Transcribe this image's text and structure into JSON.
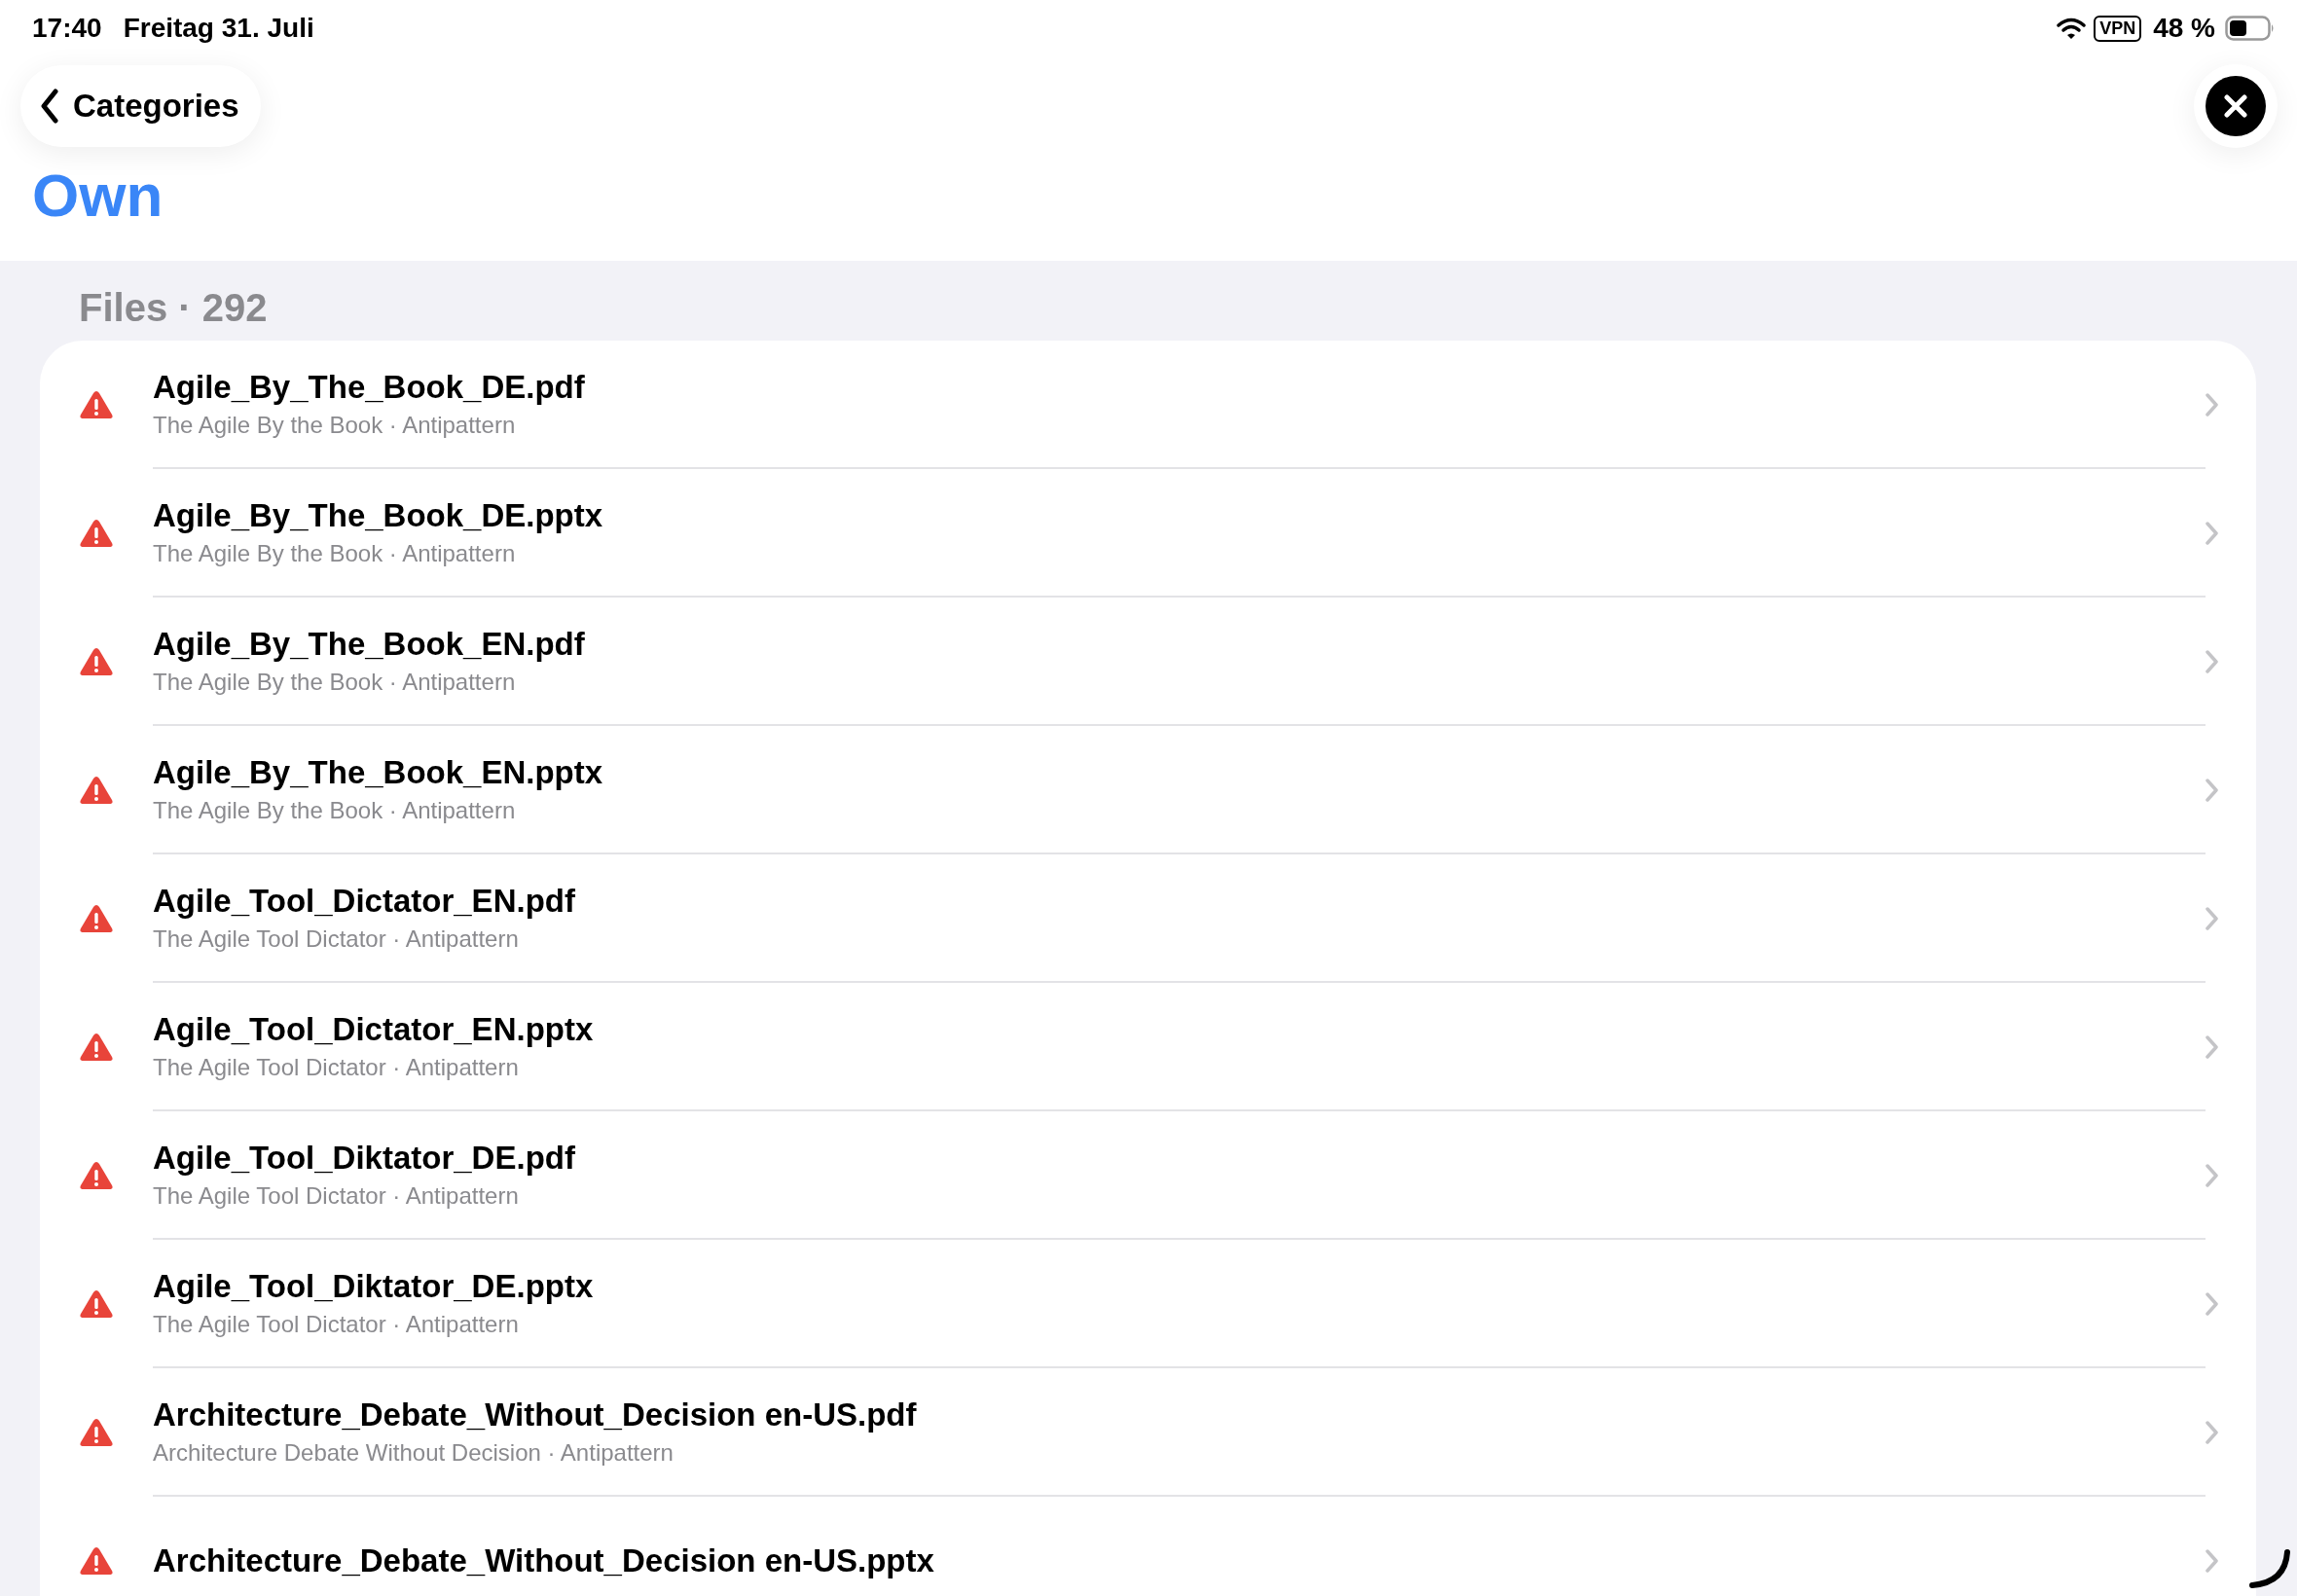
{
  "status_bar": {
    "time": "17:40",
    "date": "Freitag 31. Juli",
    "vpn": "VPN",
    "battery": "48 %"
  },
  "nav": {
    "back": "Categories",
    "title": "Own"
  },
  "section": {
    "header": "Files · 292"
  },
  "files": [
    {
      "name": "Agile_By_The_Book_DE.pdf",
      "subtitle": "The Agile By the Book · Antipattern"
    },
    {
      "name": "Agile_By_The_Book_DE.pptx",
      "subtitle": "The Agile By the Book · Antipattern"
    },
    {
      "name": "Agile_By_The_Book_EN.pdf",
      "subtitle": "The Agile By the Book · Antipattern"
    },
    {
      "name": "Agile_By_The_Book_EN.pptx",
      "subtitle": "The Agile By the Book · Antipattern"
    },
    {
      "name": "Agile_Tool_Dictator_EN.pdf",
      "subtitle": "The Agile Tool Dictator · Antipattern"
    },
    {
      "name": "Agile_Tool_Dictator_EN.pptx",
      "subtitle": "The Agile Tool Dictator · Antipattern"
    },
    {
      "name": "Agile_Tool_Diktator_DE.pdf",
      "subtitle": "The Agile Tool Dictator · Antipattern"
    },
    {
      "name": "Agile_Tool_Diktator_DE.pptx",
      "subtitle": "The Agile Tool Dictator · Antipattern"
    },
    {
      "name": "Architecture_Debate_Without_Decision en-US.pdf",
      "subtitle": "Architecture Debate Without Decision · Antipattern"
    },
    {
      "name": "Architecture_Debate_Without_Decision en-US.pptx"
    }
  ]
}
